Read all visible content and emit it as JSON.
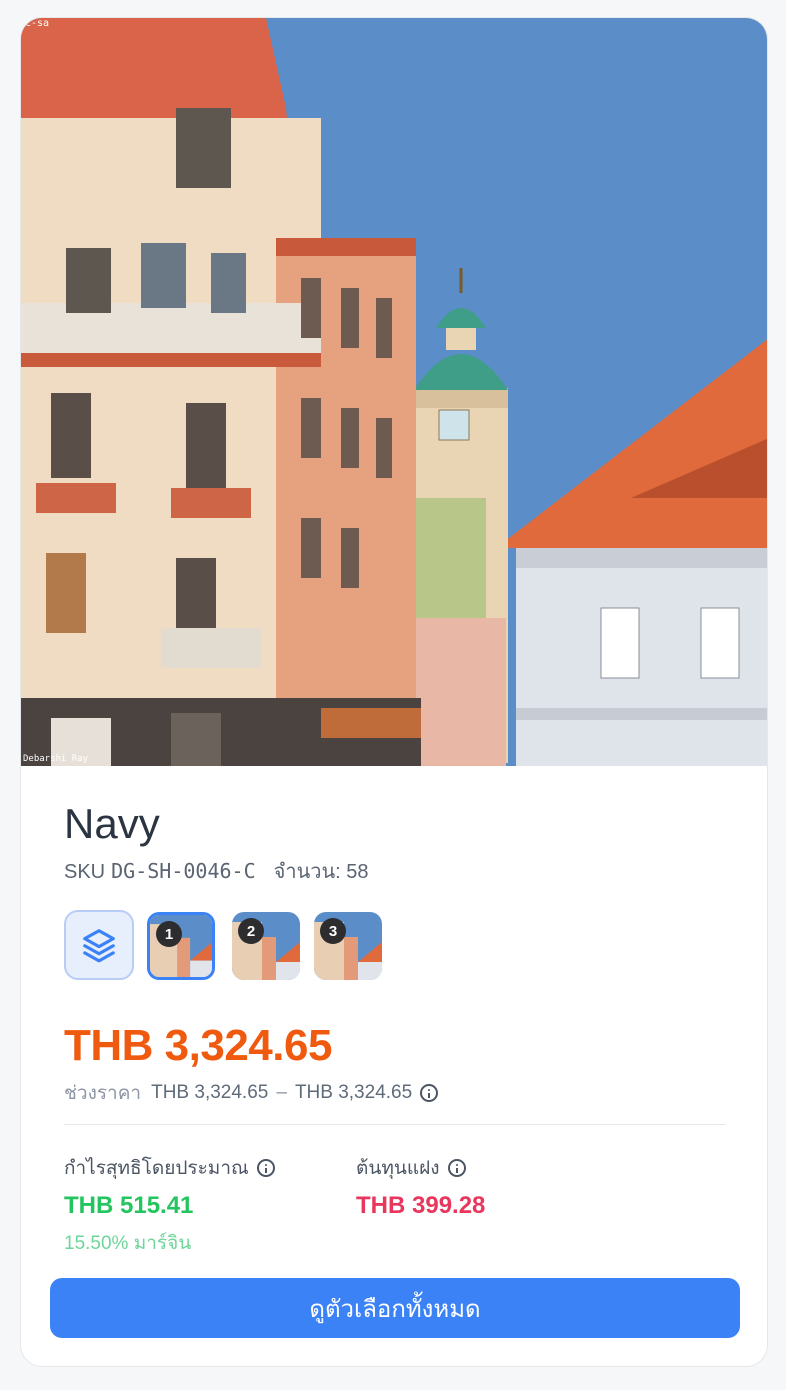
{
  "product": {
    "name": "Navy",
    "sku_label": "SKU",
    "sku": "DG-SH-0046-C",
    "quantity_text": "จำนวน: 58"
  },
  "image": {
    "watermark_top": "c-sa",
    "watermark_bottom": "Debarshi Ray"
  },
  "thumbnails": [
    {
      "number": "1",
      "active": true
    },
    {
      "number": "2",
      "active": false
    },
    {
      "number": "3",
      "active": false
    }
  ],
  "price": {
    "main": "THB 3,324.65",
    "range_label": "ช่วงราคา",
    "range_min": "THB 3,324.65",
    "range_separator": "–",
    "range_max": "THB 3,324.65"
  },
  "profit": {
    "label": "กำไรสุทธิโดยประมาณ",
    "value": "THB 515.41",
    "margin": "15.50% มาร์จิน"
  },
  "cost": {
    "label": "ต้นทุนแฝง",
    "value": "THB 399.28"
  },
  "cta_label": "ดูตัวเลือกทั้งหมด",
  "colors": {
    "accent": "#3b82f6",
    "price": "#ef5a0f",
    "profit": "#22c55e",
    "cost": "#e8365d"
  },
  "icons": [
    "layers-icon",
    "info-icon"
  ]
}
